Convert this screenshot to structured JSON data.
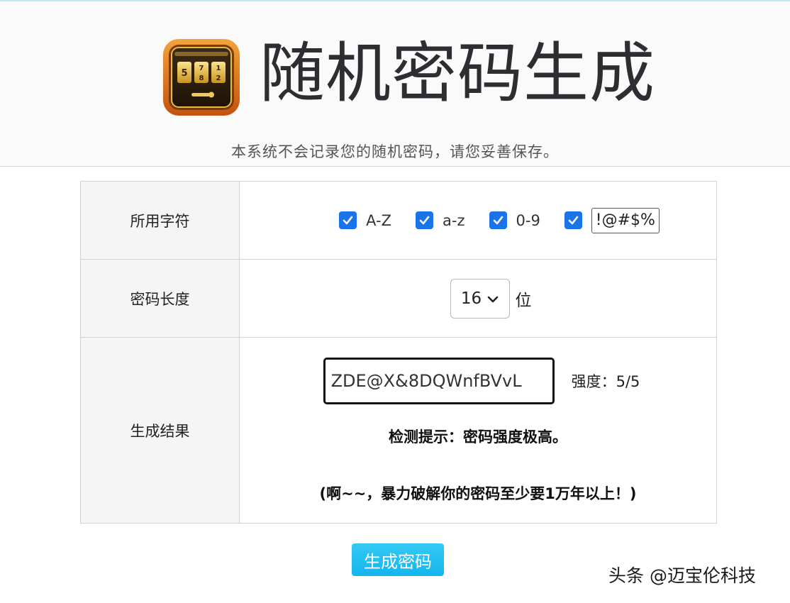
{
  "header": {
    "title": "随机密码生成",
    "subtitle": "本系统不会记录您的随机密码，请您妥善保存。",
    "logo_icon": "slot-machine-lock-icon"
  },
  "form": {
    "charset": {
      "label": "所用字符",
      "options": [
        {
          "label": "A-Z",
          "checked": true
        },
        {
          "label": "a-z",
          "checked": true
        },
        {
          "label": "0-9",
          "checked": true
        },
        {
          "label": "",
          "checked": true
        }
      ],
      "symbols_value": "!@#$%"
    },
    "length": {
      "label": "密码长度",
      "selected": "16",
      "unit": "位"
    },
    "result": {
      "label": "生成结果",
      "password": "ZDE@X&8DQWnfBVvL",
      "strength": "强度：5/5",
      "tip": "检测提示：密码强度极高。",
      "crack_time": "(啊~~，暴力破解你的密码至少要1万年以上！)"
    }
  },
  "generate_button": {
    "label": "生成密码"
  },
  "watermark": "头条 @迈宝伦科技",
  "colors": {
    "checkbox": "#1a73e8",
    "button": "#1ab8ef",
    "title": "#2e2e32"
  }
}
